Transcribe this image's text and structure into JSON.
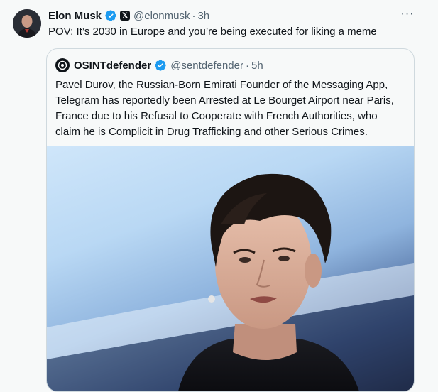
{
  "tweet": {
    "author_name": "Elon Musk",
    "author_handle": "@elonmusk",
    "separator": "·",
    "time": "3h",
    "text": "POV: It’s 2030 in Europe and you’re being executed for liking a meme",
    "more_label": "···"
  },
  "quoted_tweet": {
    "author_name": "OSINTdefender",
    "author_handle": "@sentdefender",
    "separator": "·",
    "time": "5h",
    "text_lines": [
      "Pavel Durov, the Russian-Born Emirati Founder of the Messaging App,",
      "Telegram has reportedly been Arrested at Le Bourget Airport near Paris,",
      "France due to his Refusal to Cooperate with French Authorities, who",
      "claim he is Complicit in Drug Trafficking and other Serious Crimes."
    ]
  },
  "icons": {
    "verified": "verified-badge-icon",
    "x_affiliate": "x-logo-icon",
    "more": "more-options-icon"
  },
  "colors": {
    "verified": "#1d9bf0",
    "secondary_text": "#536471",
    "border": "#cfd9de",
    "background": "#f7f9f9"
  }
}
